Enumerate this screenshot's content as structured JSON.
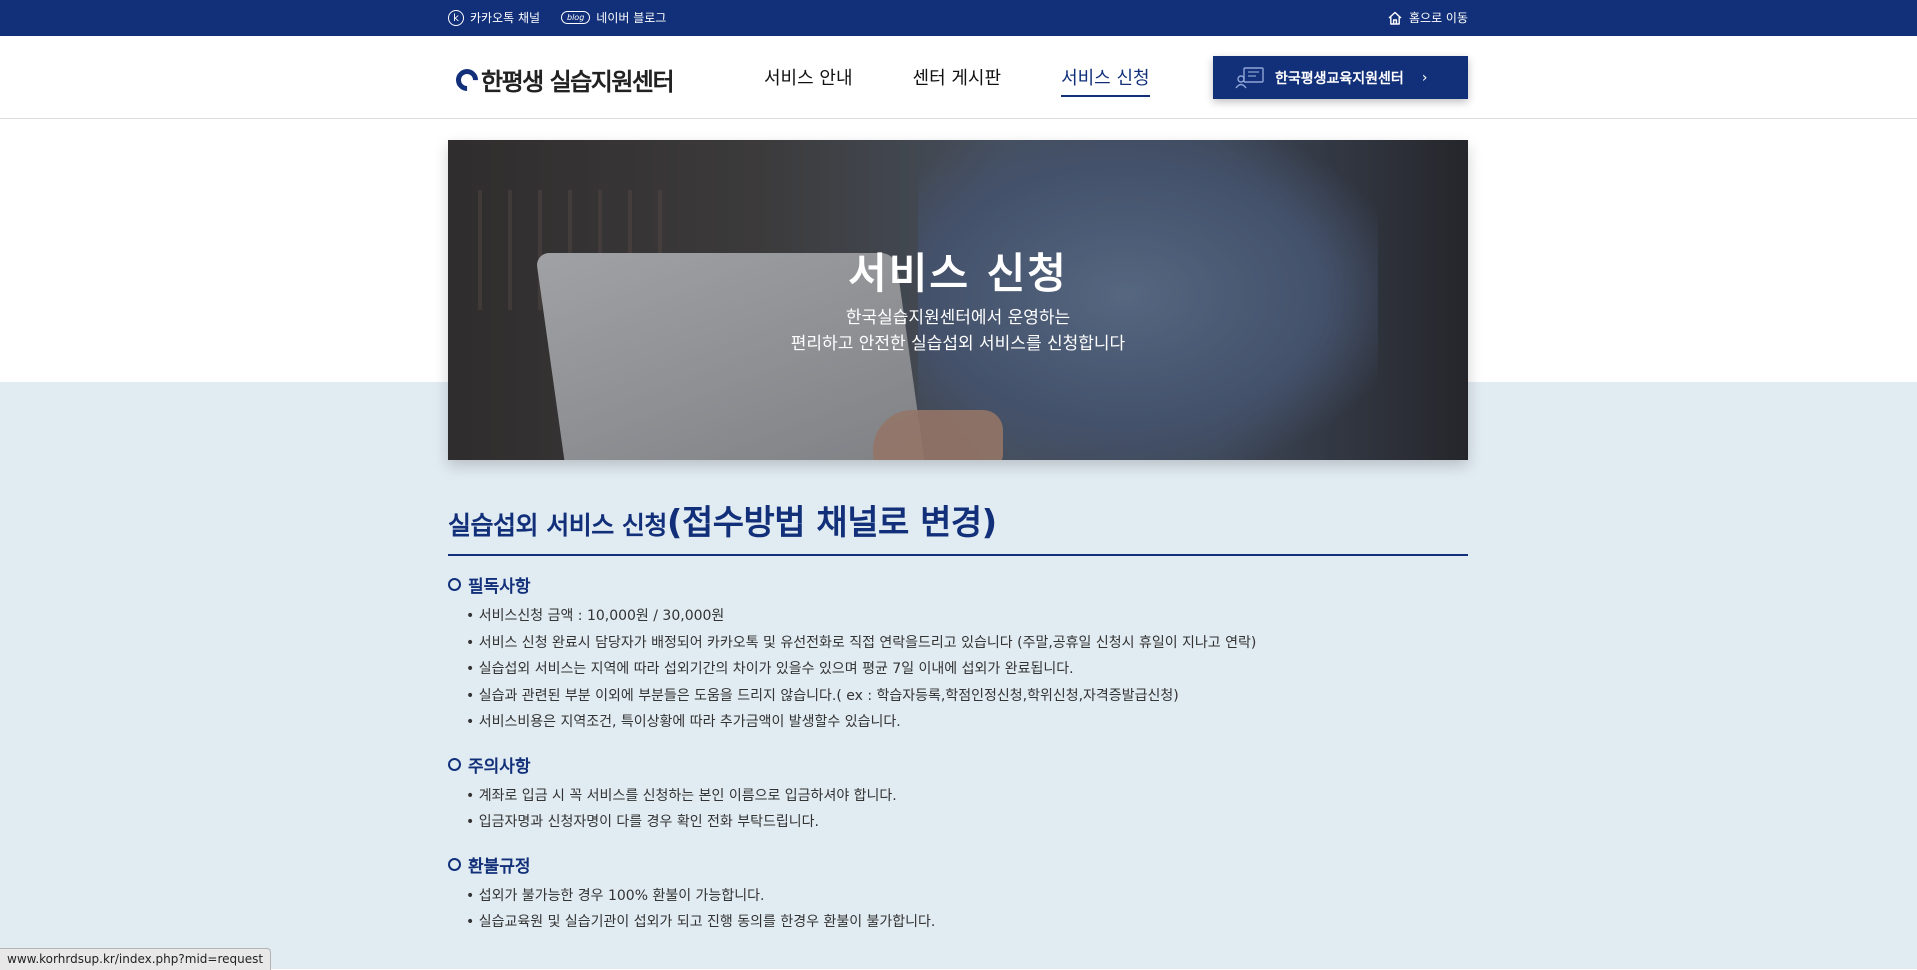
{
  "topbar": {
    "kakao_icon": "k",
    "kakao_label": "카카오톡 채널",
    "blog_icon": "blog",
    "blog_label": "네이버 블로그",
    "home_label": "홈으로 이동"
  },
  "header": {
    "logo_text": "한평생 실습지원센터",
    "nav": [
      "서비스 안내",
      "센터 게시판",
      "서비스 신청"
    ],
    "active_nav": "서비스 신청",
    "cta_label": "한국평생교육지원센터",
    "cta_arrow": "›"
  },
  "hero": {
    "title": "서비스 신청",
    "subtitle_line1": "한국실습지원센터에서 운영하는",
    "subtitle_line2": "편리하고 안전한 실습섭외 서비스를 신청합니다"
  },
  "content": {
    "title_small": "실습섭외 서비스 신청",
    "title_big": "(접수방법 채널로 변경)",
    "sections": [
      {
        "heading": "필독사항",
        "items": [
          "서비스신청 금액 : 10,000원 / 30,000원",
          "서비스 신청 완료시 담당자가 배정되어 카카오톡 및 유선전화로 직접 연락을드리고 있습니다 (주말,공휴일 신청시 휴일이 지나고 연락)",
          "실습섭외 서비스는 지역에 따라 섭외기간의 차이가 있을수 있으며 평균 7일 이내에 섭외가 완료됩니다.",
          "실습과 관련된 부분 이외에 부분들은 도움을 드리지 않습니다.( ex : 학습자등록,학점인정신청,학위신청,자격증발급신청)",
          "서비스비용은 지역조건, 특이상황에 따라 추가금액이 발생할수 있습니다."
        ]
      },
      {
        "heading": "주의사항",
        "items": [
          "계좌로 입금 시 꼭 서비스를 신청하는 본인 이름으로 입금하셔야 합니다.",
          "입금자명과 신청자명이 다를 경우 확인 전화 부탁드립니다."
        ]
      },
      {
        "heading": "환불규정",
        "items": [
          "섭외가 불가능한 경우 100% 환불이 가능합니다.",
          "실습교육원 및 실습기관이 섭외가 되고 진행 동의를 한경우 환불이 불가합니다."
        ]
      }
    ]
  },
  "statusbar": {
    "url": "www.korhrdsup.kr/index.php?mid=request"
  },
  "colors": {
    "brand": "#12307a",
    "lower_bg": "#e1ebf2"
  }
}
